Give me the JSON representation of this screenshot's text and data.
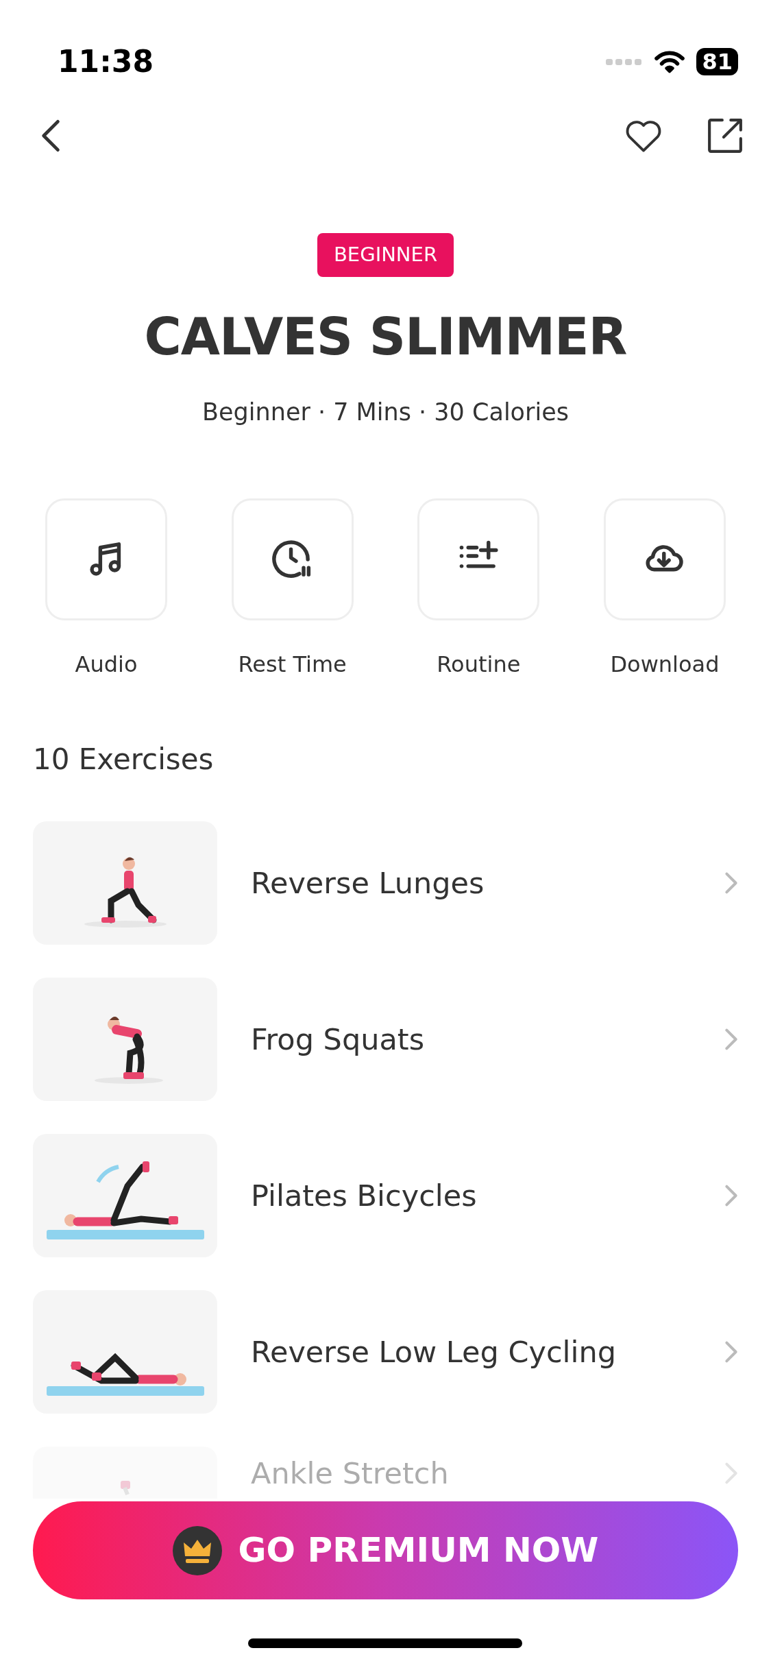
{
  "status_bar": {
    "time": "11:38",
    "battery": "81"
  },
  "badge": "BEGINNER",
  "title": "CALVES SLIMMER",
  "subtitle": "Beginner · 7 Mins · 30 Calories",
  "actions": [
    {
      "label": "Audio",
      "kind": "music"
    },
    {
      "label": "Rest Time",
      "kind": "timer"
    },
    {
      "label": "Routine",
      "kind": "list"
    },
    {
      "label": "Download",
      "kind": "download"
    }
  ],
  "section_title": "10 Exercises",
  "exercises": [
    {
      "name": "Reverse Lunges",
      "kind": "kneel",
      "faded": false
    },
    {
      "name": "Frog Squats",
      "kind": "squat",
      "faded": false
    },
    {
      "name": "Pilates Bicycles",
      "kind": "lying",
      "faded": false
    },
    {
      "name": "Reverse Low Leg Cycling",
      "kind": "lying-reverse",
      "faded": false
    },
    {
      "name": "Ankle Stretch",
      "kind": "stand",
      "faded": true
    }
  ],
  "premium_button": "GO PREMIUM NOW"
}
